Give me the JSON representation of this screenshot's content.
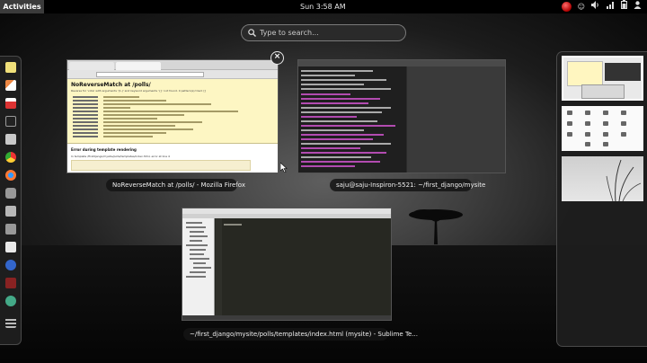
{
  "top_panel": {
    "activities_label": "Activities",
    "clock": "Sun  3:58 AM",
    "tray_icons": [
      "redhat-icon",
      "accessibility-icon",
      "volume-icon",
      "network-icon",
      "battery-icon",
      "user-menu-icon"
    ]
  },
  "search": {
    "placeholder": "Type to search..."
  },
  "dash": {
    "apps": [
      "notes-icon",
      "editor-icon",
      "calendar-icon",
      "terminal-icon",
      "files-icon",
      "chrome-icon",
      "firefox-icon",
      "settings-icon",
      "archive-icon",
      "puzzle-icon",
      "document-icon",
      "network-icon",
      "app-icon",
      "python-icon",
      "show-applications-icon"
    ]
  },
  "windows": {
    "firefox": {
      "caption": "NoReverseMatch at /polls/ - Mozilla Firefox",
      "page_title": "NoReverseMatch at /polls/",
      "sub_text": "Reverse for 'vote' with arguments '(1,)' and keyword arguments '{}' not found. 0 pattern(s) tried: []",
      "section_heading": "Error during template rendering",
      "section_line": "In template /firstdjango/mysite/polls/templates/index.html, error at line 4"
    },
    "terminal": {
      "caption": "saju@saju-Inspiron-5521: ~/first_django/mysite"
    },
    "sublime": {
      "caption": "~/first_django/mysite/polls/templates/index.html (mysite) - Sublime Te..."
    }
  },
  "workspaces": {
    "count": 3,
    "active_index": 0
  }
}
